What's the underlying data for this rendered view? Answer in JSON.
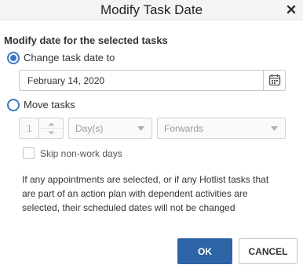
{
  "dialog": {
    "title": "Modify Task Date"
  },
  "section_title": "Modify date for the selected tasks",
  "change_date": {
    "label": "Change task date to",
    "selected": true,
    "value": "February 14, 2020"
  },
  "move_tasks": {
    "label": "Move tasks",
    "selected": false,
    "amount": "1",
    "unit": "Day(s)",
    "direction": "Forwards",
    "skip_label": "Skip non-work days",
    "skip_checked": false
  },
  "note": "If any appointments are selected, or if any Hotlist tasks that are part of an action plan with dependent activities are selected, their scheduled dates will not be changed",
  "buttons": {
    "ok": "OK",
    "cancel": "CANCEL"
  },
  "colors": {
    "accent": "#3b78c2",
    "primary_button": "#2c64a6"
  }
}
